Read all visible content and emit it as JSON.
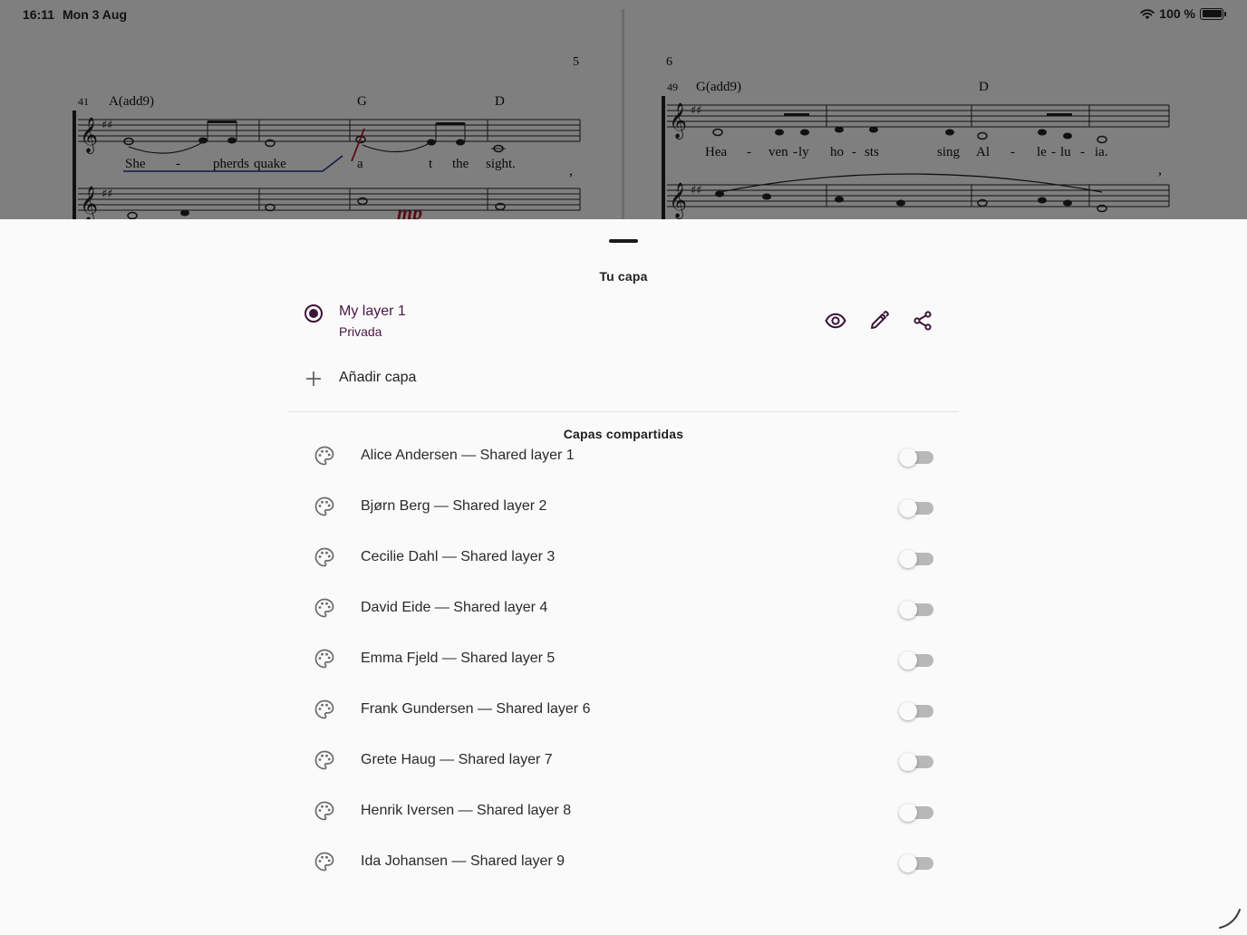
{
  "status_bar": {
    "time": "16:11",
    "date": "Mon 3 Aug",
    "battery_text": "100 %"
  },
  "score": {
    "page_left_number": "5",
    "page_right_number": "6",
    "measure_left": "41",
    "measure_right": "49",
    "chords_left": [
      "A(add9)",
      "G",
      "D"
    ],
    "chords_right": [
      "G(add9)",
      "D"
    ],
    "lyrics_left": [
      "She",
      "-",
      "pherds",
      "quake",
      "a",
      "t",
      "the",
      "sight."
    ],
    "lyrics_right": [
      "Hea",
      "-",
      "ven",
      "-",
      "ly",
      "ho",
      "-",
      "sts",
      "sing",
      "Al",
      "-",
      "le",
      "-",
      "lu",
      "-",
      "ia."
    ],
    "dynamic_mark": "mp"
  },
  "sheet": {
    "your_layer_title": "Tu capa",
    "my_layer": {
      "name": "My layer 1",
      "visibility": "Privada",
      "selected": true
    },
    "add_layer_label": "Añadir capa",
    "shared_layers_title": "Capas compartidas",
    "shared_layers": [
      {
        "label": "Alice Andersen — Shared layer 1",
        "enabled": false
      },
      {
        "label": "Bjørn Berg — Shared layer 2",
        "enabled": false
      },
      {
        "label": "Cecilie Dahl — Shared layer 3",
        "enabled": false
      },
      {
        "label": "David Eide — Shared layer 4",
        "enabled": false
      },
      {
        "label": "Emma Fjeld — Shared layer 5",
        "enabled": false
      },
      {
        "label": "Frank Gundersen — Shared layer 6",
        "enabled": false
      },
      {
        "label": "Grete Haug — Shared layer 7",
        "enabled": false
      },
      {
        "label": "Henrik Iversen — Shared layer 8",
        "enabled": false
      },
      {
        "label": "Ida Johansen — Shared layer 9",
        "enabled": false
      }
    ]
  },
  "colors": {
    "accent": "#4a1646",
    "annotation_blue": "#1e2f8a",
    "annotation_red": "#b01a2a",
    "toggle_off": "#b8b8b8"
  }
}
